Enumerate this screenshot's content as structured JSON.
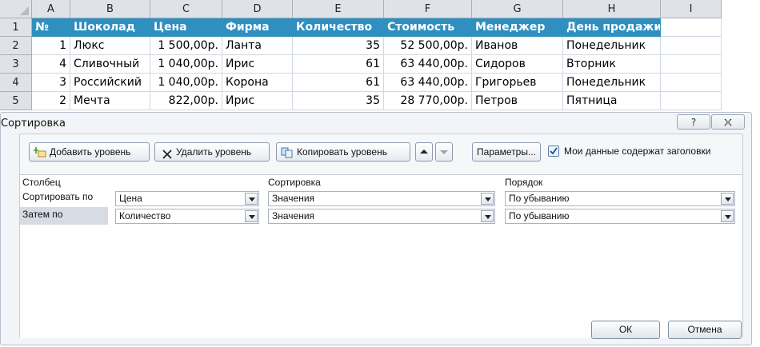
{
  "sheet": {
    "columns": [
      "A",
      "B",
      "C",
      "D",
      "E",
      "F",
      "G",
      "H",
      "I"
    ],
    "row_numbers": [
      "1",
      "2",
      "3",
      "4",
      "5"
    ],
    "headers": [
      "№",
      "Шоколад",
      "Цена",
      "Фирма",
      "Количество",
      "Стоимость",
      "Менеджер",
      "День продажи"
    ],
    "rows": [
      [
        "1",
        "Люкс",
        "1 500,00р.",
        "Ланта",
        "35",
        "52 500,00р.",
        "Иванов",
        "Понедельник"
      ],
      [
        "4",
        "Сливочный",
        "1 040,00р.",
        "Ирис",
        "61",
        "63 440,00р.",
        "Сидоров",
        "Вторник"
      ],
      [
        "3",
        "Российский",
        "1 040,00р.",
        "Корона",
        "61",
        "63 440,00р.",
        "Григорьев",
        "Понедельник"
      ],
      [
        "2",
        "Мечта",
        "822,00р.",
        "Ирис",
        "35",
        "28 770,00р.",
        "Петров",
        "Пятница"
      ]
    ]
  },
  "dialog": {
    "title": "Сортировка",
    "help_icon": "question-mark-icon",
    "close_icon": "close-icon",
    "toolbar": {
      "add_level": "Добавить уровень",
      "delete_level": "Удалить уровень",
      "copy_level": "Копировать уровень",
      "options": "Параметры...",
      "headers_checkbox": "Мои данные содержат заголовки",
      "headers_checked": true
    },
    "grid_headers": {
      "column": "Столбец",
      "sort": "Сортировка",
      "order": "Порядок"
    },
    "levels": [
      {
        "label": "Сортировать по",
        "column": "Цена",
        "sort_on": "Значения",
        "order": "По убыванию"
      },
      {
        "label": "Затем по",
        "column": "Количество",
        "sort_on": "Значения",
        "order": "По убыванию"
      }
    ],
    "ok_label": "ОК",
    "cancel_label": "Отмена"
  },
  "colors": {
    "header_fill": "#2f8fbf",
    "header_text": "#ffffff",
    "dialog_bg": "#f2f4f7"
  }
}
